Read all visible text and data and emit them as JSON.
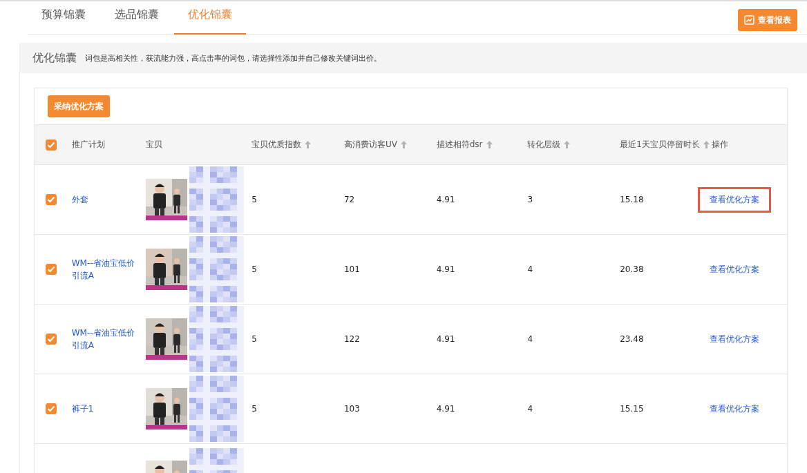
{
  "tabs": [
    {
      "label": "预算锦囊",
      "selected": false
    },
    {
      "label": "选品锦囊",
      "selected": false
    },
    {
      "label": "优化锦囊",
      "selected": true
    }
  ],
  "report_button": "查看报表",
  "banner": {
    "title": "优化锦囊",
    "description": "词包是高相关性，获流能力强，高点击率的词包，请选择性添加并自己修改关键词出价。"
  },
  "adopt_button": "采纳优化方案",
  "table": {
    "select_all": {
      "checked": true
    },
    "columns": [
      {
        "label": "推广计划",
        "sortable": false
      },
      {
        "label": "宝贝",
        "sortable": false
      },
      {
        "label": "宝贝优质指数",
        "sortable": true
      },
      {
        "label": "高消费访客UV",
        "sortable": true
      },
      {
        "label": "描述相符dsr",
        "sortable": true
      },
      {
        "label": "转化层级",
        "sortable": true
      },
      {
        "label": "最近1天宝贝停留时长",
        "sortable": true
      },
      {
        "label": "操作",
        "sortable": false
      }
    ],
    "rows": [
      {
        "checked": true,
        "plan": "外套",
        "product": {
          "kind": "picture"
        },
        "quality": "5",
        "uv": "72",
        "dsr": "4.91",
        "level": "3",
        "stay": "15.18",
        "action": "查看优化方案",
        "highlighted": true
      },
      {
        "checked": true,
        "plan": "WM--省油宝低价引流A",
        "product": {
          "kind": "picture"
        },
        "quality": "5",
        "uv": "101",
        "dsr": "4.91",
        "level": "4",
        "stay": "20.38",
        "action": "查看优化方案",
        "highlighted": false
      },
      {
        "checked": true,
        "plan": "WM--省油宝低价引流A",
        "product": {
          "kind": "picture"
        },
        "quality": "5",
        "uv": "122",
        "dsr": "4.91",
        "level": "4",
        "stay": "23.48",
        "action": "查看优化方案",
        "highlighted": false
      },
      {
        "checked": true,
        "plan": "裤子1",
        "product": {
          "kind": "picture"
        },
        "quality": "5",
        "uv": "103",
        "dsr": "4.91",
        "level": "4",
        "stay": "15.15",
        "action": "查看优化方案",
        "highlighted": false
      },
      {
        "product": {
          "kind": "picture"
        }
      }
    ]
  }
}
